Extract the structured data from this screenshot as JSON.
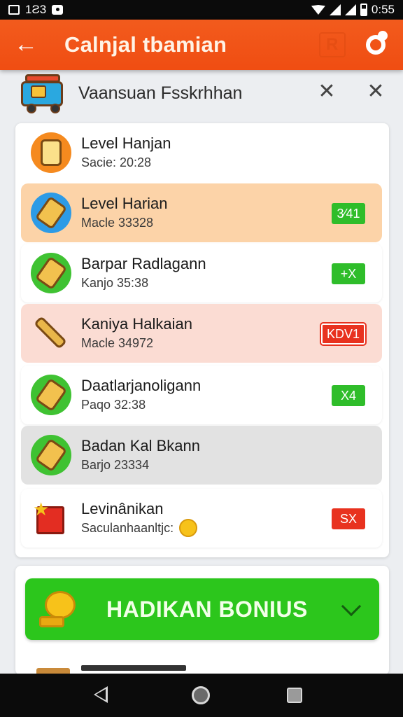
{
  "status_bar": {
    "left_text": "1Ƨ3",
    "time": "0:55"
  },
  "app_bar": {
    "title": "Calnjal tbamian"
  },
  "sub_header": {
    "title": "Vaansuan Fsskrhhan"
  },
  "list": [
    {
      "title": "Level Hanjan",
      "subtitle": "Sacie: 20:28",
      "badge": "",
      "icon": "jar-icon",
      "bg": "white"
    },
    {
      "title": "Level Harian",
      "subtitle": "Macle 33328",
      "badge": "3⁄41",
      "icon": "pencil-icon",
      "bg": "orange"
    },
    {
      "title": "Barpar Radlagann",
      "subtitle": "Kanjo 35:38",
      "badge": "+X",
      "icon": "bell-icon",
      "bg": "white"
    },
    {
      "title": "Kaniya Halkaian",
      "subtitle": "Macle 34972",
      "badge": "KDV1",
      "icon": "paintbrush-icon",
      "bg": "pink"
    },
    {
      "title": "Daatlarjanoligann",
      "subtitle": "Paqo 32:38",
      "badge": "X4",
      "icon": "bell-icon",
      "bg": "white"
    },
    {
      "title": "Badan Kal  Bkann",
      "subtitle": "Barjo 23334",
      "badge": "",
      "icon": "tag-icon",
      "bg": "gray"
    },
    {
      "title": "Levinânikan",
      "subtitle": "Saculanhaanltjc:",
      "badge": "SX",
      "icon": "flag-icon",
      "bg": "white"
    }
  ],
  "bonus": {
    "label": "HADIKAN BONIUS"
  },
  "colors": {
    "app_bar": "#f04d12",
    "badge_green": "#2fbd2a",
    "badge_red": "#e8321f",
    "bonus_green": "#2cc61c"
  }
}
